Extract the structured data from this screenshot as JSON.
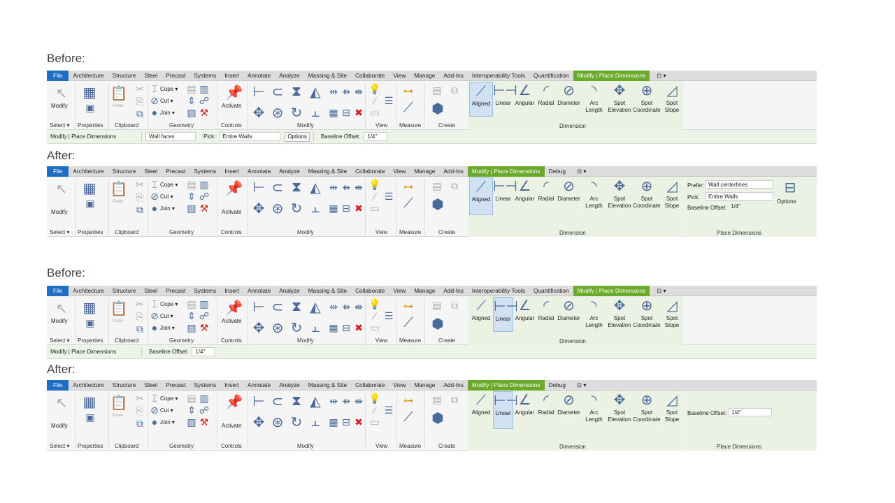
{
  "headings": {
    "before1": "Before:",
    "after1": "After:",
    "before2": "Before:",
    "after2": "After:"
  },
  "tabs_before": [
    "File",
    "Architecture",
    "Structure",
    "Steel",
    "Precast",
    "Systems",
    "Insert",
    "Annotate",
    "Analyze",
    "Massing & Site",
    "Collaborate",
    "View",
    "Manage",
    "Add-Ins",
    "Interoperability Tools",
    "Quantification",
    "Modify | Place Dimensions"
  ],
  "tabs_after": [
    "File",
    "Architecture",
    "Structure",
    "Steel",
    "Precast",
    "Systems",
    "Insert",
    "Annotate",
    "Analyze",
    "Massing & Site",
    "Collaborate",
    "View",
    "Manage",
    "Add-Ins",
    "Modify | Place Dimensions",
    "Debug"
  ],
  "qat": "⊡ ▾",
  "ribbon": {
    "modify": "Modify",
    "select": "Select ▾",
    "properties": "Properties",
    "clipboard": "Clipboard",
    "paste": "Paste",
    "cope": "Cope ▾",
    "cut": "Cut ▾",
    "join": "Join ▾",
    "geometry": "Geometry",
    "activate": "Activate",
    "controls": "Controls",
    "modify_panel": "Modify",
    "view": "View",
    "measure": "Measure",
    "create": "Create",
    "dimension": "Dimension",
    "place_dimensions": "Place Dimensions"
  },
  "dim_tools": [
    {
      "l1": "Aligned",
      "l2": ""
    },
    {
      "l1": "Linear",
      "l2": ""
    },
    {
      "l1": "Angular",
      "l2": ""
    },
    {
      "l1": "Radial",
      "l2": ""
    },
    {
      "l1": "Diameter",
      "l2": ""
    },
    {
      "l1": "Arc",
      "l2": "Length"
    },
    {
      "l1": "Spot",
      "l2": "Elevation"
    },
    {
      "l1": "Spot",
      "l2": "Coordinate"
    },
    {
      "l1": "Spot",
      "l2": "Slope"
    }
  ],
  "options_bar_1": {
    "context": "Modify | Place Dimensions",
    "placement": "Wall faces",
    "pick_label": "Pick:",
    "pick_value": "Entire Walls",
    "options_btn": "Options",
    "baseline_label": "Baseline Offset:",
    "baseline_value": "1/4\""
  },
  "place_dims_1": {
    "prefer_label": "Prefer:",
    "prefer_value": "Wall centerlines",
    "pick_label": "Pick:",
    "pick_value": "Entire Walls",
    "baseline_label": "Baseline Offset:",
    "baseline_value": "1/4\"",
    "options_label": "Options"
  },
  "options_bar_2": {
    "context": "Modify | Place Dimensions",
    "baseline_label": "Baseline Offset:",
    "baseline_value": "1/4\""
  },
  "place_dims_2": {
    "baseline_label": "Baseline Offset:",
    "baseline_value": "1/4\""
  },
  "colors": {
    "file_tab": "#1e6fc4",
    "context_tab": "#6aaa2a",
    "dimension_panel": "#ebf1e3",
    "selected_tool": "#cfe1f3"
  },
  "icons": [
    "select-arrow-icon",
    "properties-icon",
    "paste-icon",
    "scissors-icon",
    "cope-icon",
    "cut-geometry-icon",
    "join-icon",
    "activate-controls-icon",
    "align-icon",
    "offset-icon",
    "mirror-icon",
    "move-icon",
    "copy-icon",
    "rotate-icon",
    "trim-icon",
    "delete-icon",
    "measure-icon",
    "create-assembly-icon"
  ]
}
